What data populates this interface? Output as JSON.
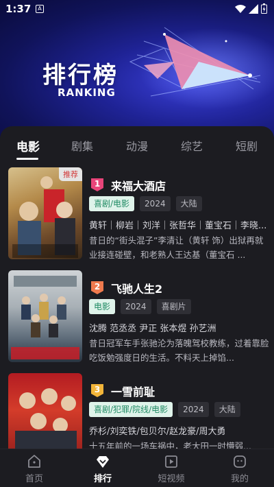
{
  "status_bar": {
    "time": "1:37",
    "notif_icon": "A"
  },
  "banner": {
    "title": "排行榜",
    "subtitle": "RANKING"
  },
  "tabs": [
    {
      "label": "电影",
      "active": true
    },
    {
      "label": "剧集",
      "active": false
    },
    {
      "label": "动漫",
      "active": false
    },
    {
      "label": "综艺",
      "active": false
    },
    {
      "label": "短剧",
      "active": false
    }
  ],
  "items": [
    {
      "rank": "1",
      "rank_color": "#e8457a",
      "title": "来福大酒店",
      "badge": "推荐",
      "tags": [
        "喜剧/电影",
        "2024",
        "大陆"
      ],
      "cast": "黄轩｜柳岩｜刘洋｜张哲华｜董宝石｜李晓...",
      "desc": "昔日的“街头混子”李清让（黄轩 饰）出狱再就业接连碰壁，和老熟人王达基（董宝石 ..."
    },
    {
      "rank": "2",
      "rank_color": "#ef7a4e",
      "title": "飞驰人生2",
      "badge": "",
      "tags": [
        "电影",
        "2024",
        "喜剧片"
      ],
      "cast": "沈腾 范丞丞 尹正 张本煜 孙艺洲",
      "desc": "昔日冠军车手张驰沦为落魄驾校教练，过着靠脸吃饭勉强度日的生活。不料天上掉馅..."
    },
    {
      "rank": "3",
      "rank_color": "#f2b53a",
      "title": "一雪前耻",
      "badge": "",
      "tags": [
        "喜剧/犯罪/院线/电影",
        "2024",
        "大陆"
      ],
      "cast": "乔杉/刘奕铁/包贝尔/赵龙豪/周大勇",
      "desc": "十五年前的一场车祸中，老大田一时懵弱..."
    }
  ],
  "bottom_nav": [
    {
      "label": "首页",
      "icon": "home-icon",
      "active": false
    },
    {
      "label": "排行",
      "icon": "ranking-diamond-icon",
      "active": true
    },
    {
      "label": "短视频",
      "icon": "play-icon",
      "active": false
    },
    {
      "label": "我的",
      "icon": "profile-icon",
      "active": false
    }
  ],
  "colors": {
    "accent_genre_bg": "#dff3ea",
    "accent_genre_fg": "#1f8a63",
    "background": "#1c1c21"
  }
}
